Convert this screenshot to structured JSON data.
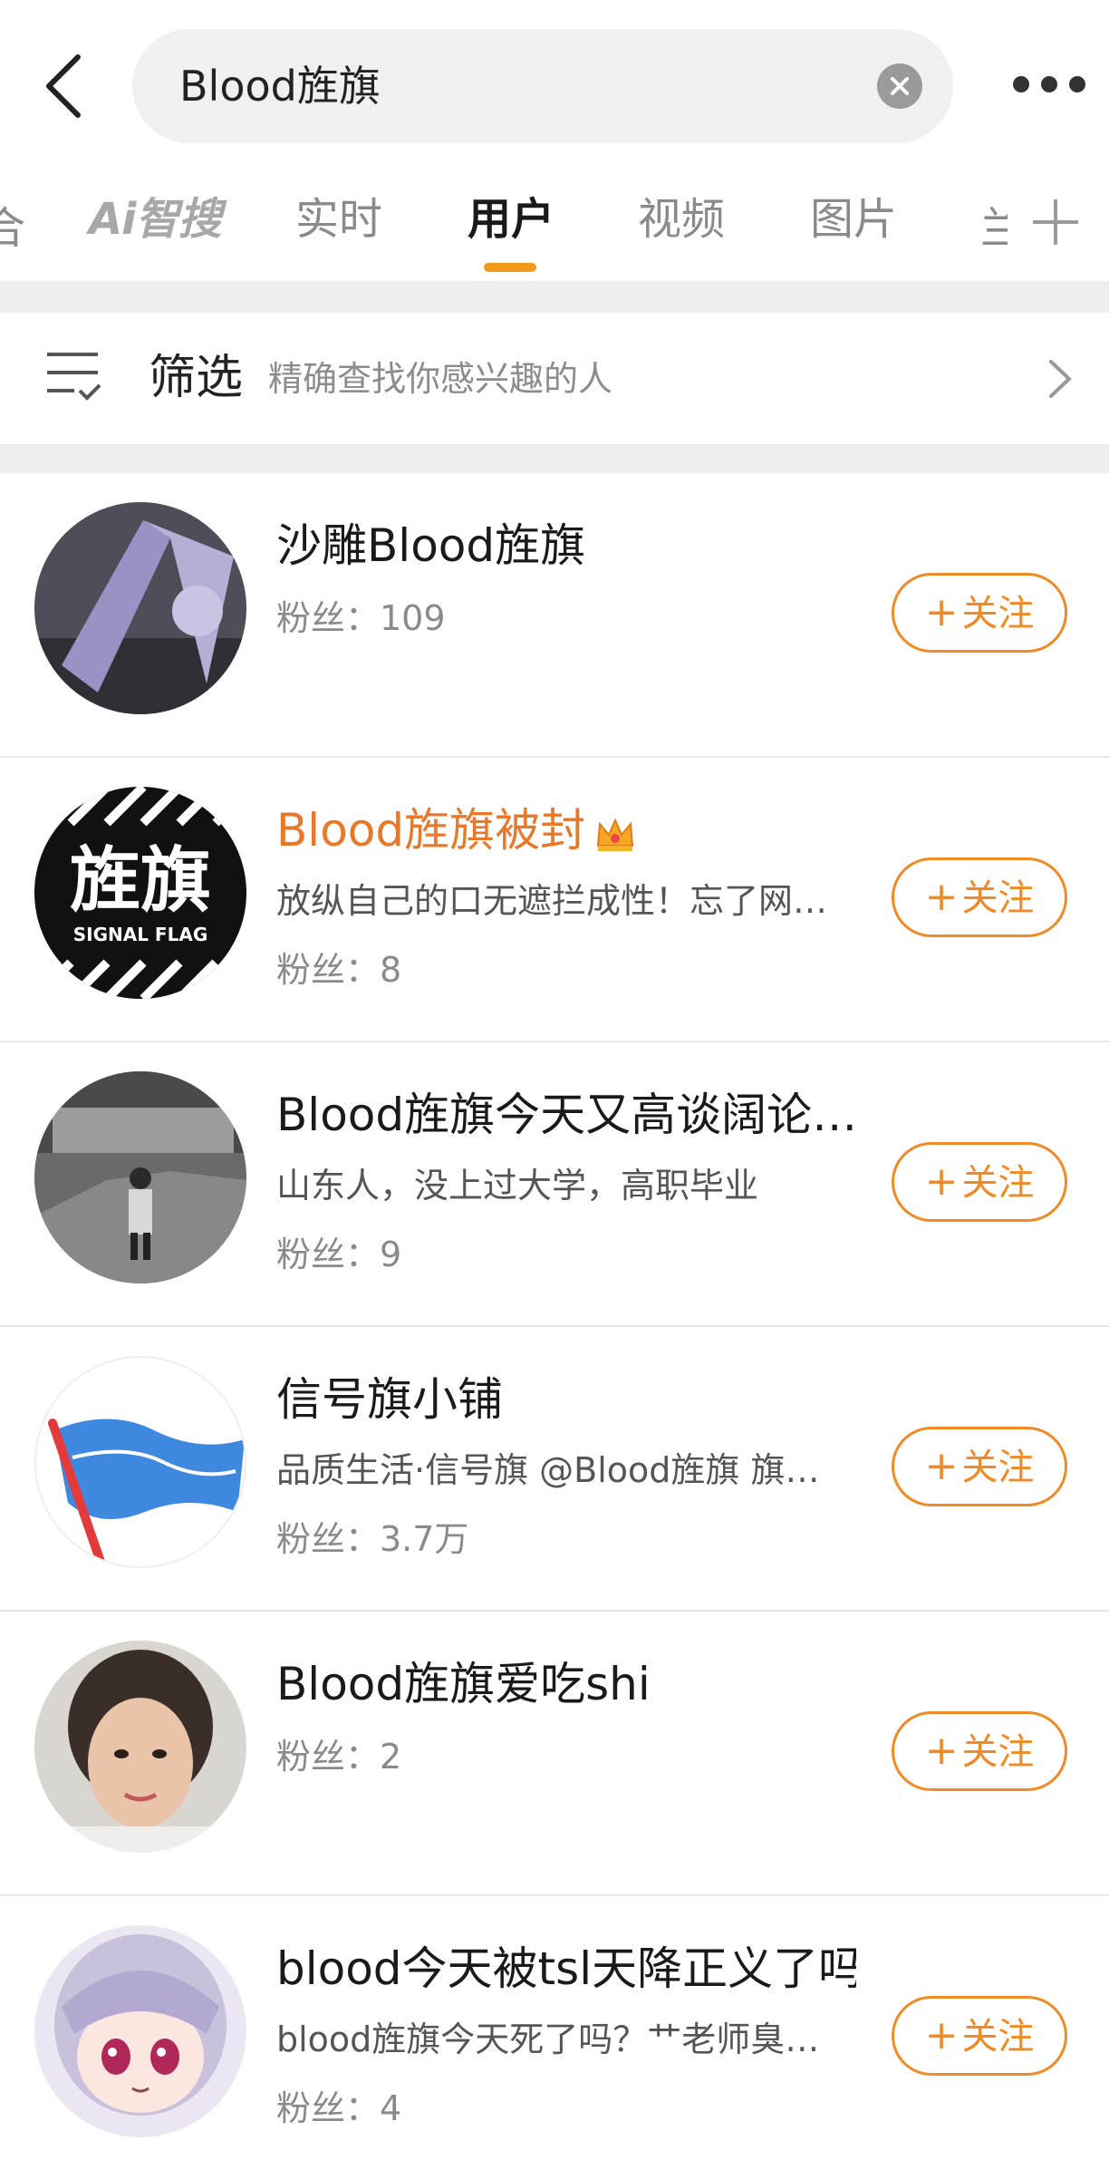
{
  "header": {
    "search_value": "Blood旌旗",
    "icons": {
      "back": "chevron-left-icon",
      "clear": "clear-icon",
      "more": "more-dots-icon"
    }
  },
  "tabs": {
    "items": [
      {
        "label": "Ai智搜"
      },
      {
        "label": "实时"
      },
      {
        "label": "用户",
        "active": true
      },
      {
        "label": "视频"
      },
      {
        "label": "图片"
      },
      {
        "label": "兰"
      }
    ],
    "left_partial": "合",
    "accent_color": "#f39a1b"
  },
  "filter": {
    "label": "筛选",
    "hint": "精确查找你感兴趣的人"
  },
  "users": [
    {
      "name": "沙雕Blood旌旗",
      "desc": "",
      "fans": "粉丝：109",
      "follow": "关注",
      "vip": false
    },
    {
      "name": "Blood旌旗被封",
      "desc": "放纵自己的口无遮拦成性！忘了网…",
      "fans": "粉丝：8",
      "follow": "关注",
      "vip": true
    },
    {
      "name": "Blood旌旗今天又高谈阔论…",
      "desc": "山东人，没上过大学，高职毕业",
      "fans": "粉丝：9",
      "follow": "关注",
      "vip": false
    },
    {
      "name": "信号旗小铺",
      "desc": "品质生活·信号旗 @Blood旌旗 旗…",
      "fans": "粉丝：3.7万",
      "follow": "关注",
      "vip": false
    },
    {
      "name": "Blood旌旗爱吃shi",
      "desc": "",
      "fans": "粉丝：2",
      "follow": "关注",
      "vip": false
    },
    {
      "name": "blood今天被tsl天降正义了吗",
      "desc": "blood旌旗今天死了吗？艹老师臭…",
      "fans": "粉丝：4",
      "follow": "关注",
      "vip": false
    }
  ],
  "avatar2_text": {
    "big": "旌旗",
    "small": "SIGNAL FLAG"
  },
  "colors": {
    "follow": "#f08a24",
    "vip_name": "#e8792b"
  }
}
